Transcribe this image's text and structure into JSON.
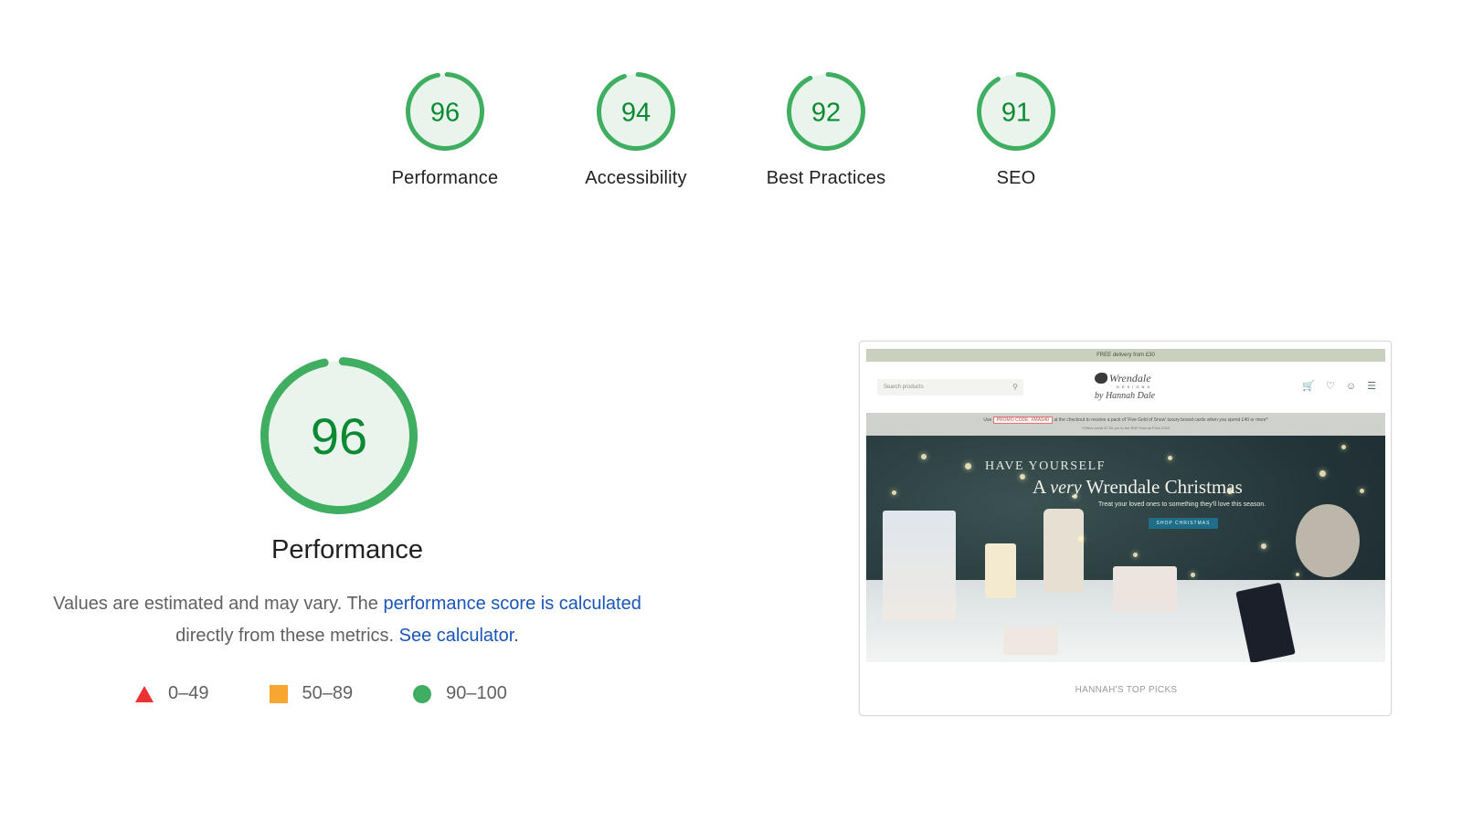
{
  "colors": {
    "pass": "#0c8a33",
    "pass_ring": "#3fae60",
    "pass_fill": "#e9f4ec",
    "average": "#f7a632",
    "fail": "#eb3232",
    "link": "#1a55b8"
  },
  "categories": [
    {
      "label": "Performance",
      "score": 96
    },
    {
      "label": "Accessibility",
      "score": 94
    },
    {
      "label": "Best Practices",
      "score": 92
    },
    {
      "label": "SEO",
      "score": 91
    }
  ],
  "performance": {
    "score": 96,
    "title": "Performance",
    "description_prefix": "Values are estimated and may vary. The ",
    "link_score": "performance score is calculated",
    "description_middle": " directly from these metrics. ",
    "link_calculator": "See calculator.",
    "legend": [
      {
        "icon": "triangle-fail-icon",
        "range": "0–49"
      },
      {
        "icon": "square-average-icon",
        "range": "50–89"
      },
      {
        "icon": "circle-pass-icon",
        "range": "90–100"
      }
    ]
  },
  "preview": {
    "banner": "FREE delivery from £30",
    "search_placeholder": "Search products",
    "logo_brand": "Wrendale",
    "logo_sub": "DESIGNS",
    "logo_signature": "by Hannah Dale",
    "promo_prefix": "Use",
    "promo_code": "PROMO CODE: XMAS40",
    "promo_suffix": "at the checkout to receive a pack of 'Five Gold of Snow' luxury boxed cards when you spend £40 or more*",
    "promo_note": "*Offers worth £7.00 per to the RRP Normal Price 2023",
    "hero_line1": "HAVE YOURSELF",
    "hero_line2_a": "A ",
    "hero_line2_em": "very",
    "hero_line2_b": " Wrendale Christmas",
    "hero_line3": "Treat your loved ones to something they'll love this season.",
    "hero_button": "SHOP CHRISTMAS",
    "section_title": "HANNAH'S TOP PICKS",
    "icons": [
      "basket-icon",
      "heart-icon",
      "account-icon",
      "menu-icon"
    ]
  }
}
